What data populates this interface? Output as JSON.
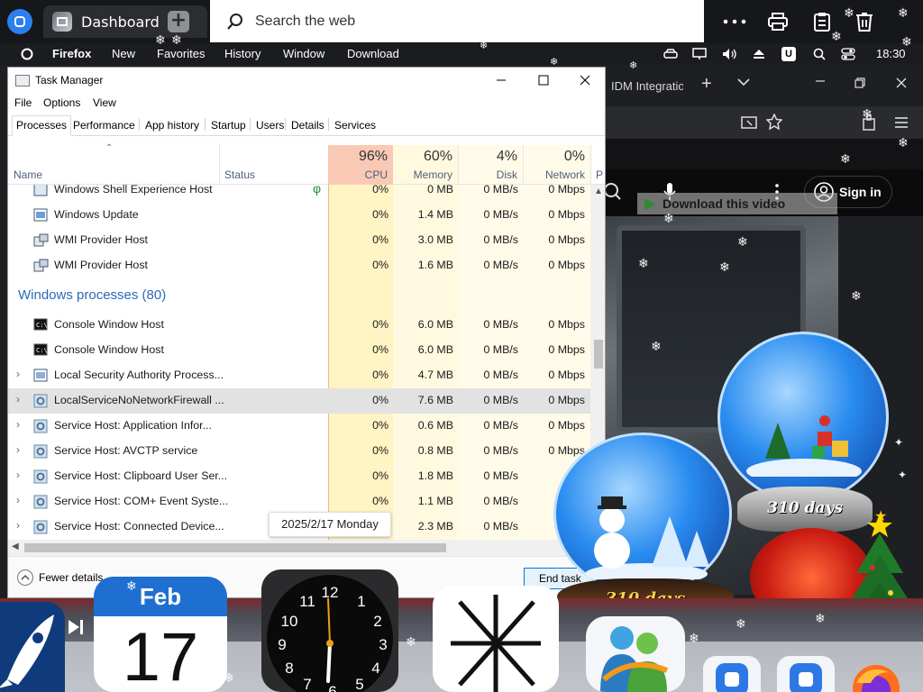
{
  "topbar": {
    "dashboard_tab": "Dashboard",
    "search_placeholder": "Search the web",
    "icons": [
      "app-badge-icon",
      "dashboard-icon",
      "new-tab-plus-icon",
      "search-icon",
      "more-dots-icon",
      "print-icon",
      "clipboard-icon",
      "trash-icon"
    ]
  },
  "menubar": {
    "app_name": "Firefox",
    "items": [
      "New",
      "Favorites",
      "History",
      "Window",
      "Download"
    ],
    "time": "18:30",
    "u_badge": "U"
  },
  "firefox": {
    "tab_title": "IDM Integratio",
    "sign_in": "Sign in",
    "download_banner": "Download this video"
  },
  "taskmanager": {
    "title": "Task Manager",
    "menu": [
      "File",
      "Options",
      "View"
    ],
    "tabs": [
      "Processes",
      "Performance",
      "App history",
      "Startup",
      "Users",
      "Details",
      "Services"
    ],
    "active_tab": "Processes",
    "columns": {
      "name": "Name",
      "status": "Status",
      "cpu": {
        "pct": "96%",
        "label": "CPU"
      },
      "memory": {
        "pct": "60%",
        "label": "Memory"
      },
      "disk": {
        "pct": "4%",
        "label": "Disk"
      },
      "network": {
        "pct": "0%",
        "label": "Network"
      },
      "extra": "P"
    },
    "rows_top": [
      {
        "name": "Windows Shell Experience Host",
        "cpu": "0%",
        "mem": "0 MB",
        "disk": "0 MB/s",
        "net": "0 Mbps",
        "icon": "shell-icon"
      },
      {
        "name": "Windows Update",
        "cpu": "0%",
        "mem": "1.4 MB",
        "disk": "0 MB/s",
        "net": "0 Mbps",
        "icon": "update-icon"
      },
      {
        "name": "WMI Provider Host",
        "cpu": "0%",
        "mem": "3.0 MB",
        "disk": "0 MB/s",
        "net": "0 Mbps",
        "icon": "wmi-icon"
      },
      {
        "name": "WMI Provider Host",
        "cpu": "0%",
        "mem": "1.6 MB",
        "disk": "0 MB/s",
        "net": "0 Mbps",
        "icon": "wmi-icon"
      }
    ],
    "group_header": "Windows processes (80)",
    "rows_group": [
      {
        "name": "Console Window Host",
        "cpu": "0%",
        "mem": "6.0 MB",
        "disk": "0 MB/s",
        "net": "0 Mbps",
        "icon": "console-icon"
      },
      {
        "name": "Console Window Host",
        "cpu": "0%",
        "mem": "6.0 MB",
        "disk": "0 MB/s",
        "net": "0 Mbps",
        "icon": "console-icon"
      },
      {
        "name": "Local Security Authority Process...",
        "cpu": "0%",
        "mem": "4.7 MB",
        "disk": "0 MB/s",
        "net": "0 Mbps",
        "icon": "lsa-icon"
      },
      {
        "name": "LocalServiceNoNetworkFirewall ...",
        "cpu": "0%",
        "mem": "7.6 MB",
        "disk": "0 MB/s",
        "net": "0 Mbps",
        "icon": "gear-icon"
      },
      {
        "name": "Service Host: Application Infor...",
        "cpu": "0%",
        "mem": "0.6 MB",
        "disk": "0 MB/s",
        "net": "0 Mbps",
        "icon": "gear-icon"
      },
      {
        "name": "Service Host: AVCTP service",
        "cpu": "0%",
        "mem": "0.8 MB",
        "disk": "0 MB/s",
        "net": "0 Mbps",
        "icon": "gear-icon"
      },
      {
        "name": "Service Host: Clipboard User Ser...",
        "cpu": "0%",
        "mem": "1.8 MB",
        "disk": "0 MB/s",
        "net": "0 M",
        "icon": "gear-icon"
      },
      {
        "name": "Service Host: COM+ Event Syste...",
        "cpu": "0%",
        "mem": "1.1 MB",
        "disk": "0 MB/s",
        "net": "0",
        "icon": "gear-icon"
      },
      {
        "name": "Service Host: Connected Device...",
        "cpu": "0%",
        "mem": "2.3 MB",
        "disk": "0 MB/s",
        "net": "0",
        "icon": "gear-icon"
      }
    ],
    "fewer_details": "Fewer details",
    "end_task": "End task",
    "tooltip": "2025/2/17 Monday"
  },
  "dock": {
    "calendar_month": "Feb",
    "calendar_day": "17",
    "clock_numbers": [
      "12",
      "1",
      "2",
      "3",
      "4",
      "5",
      "6",
      "7",
      "8",
      "9",
      "10",
      "11"
    ],
    "apps": [
      "rocket-app-icon",
      "calendar-app-icon",
      "clock-app-icon",
      "asterisk-app-icon",
      "msn-messenger-app-icon",
      "blue-app-icon",
      "blue-app-icon",
      "firefox-app-icon"
    ]
  },
  "widgets": {
    "globe_small_label": "310 days",
    "globe_large_label": "310 days"
  },
  "colors": {
    "cpu_header_bg": "#f9c9b6",
    "cpu_col_bg": "#fff4c4",
    "col_bg": "#fff9e0",
    "group_header": "#2a6ab8",
    "calendar_blue": "#1f6fd0"
  }
}
